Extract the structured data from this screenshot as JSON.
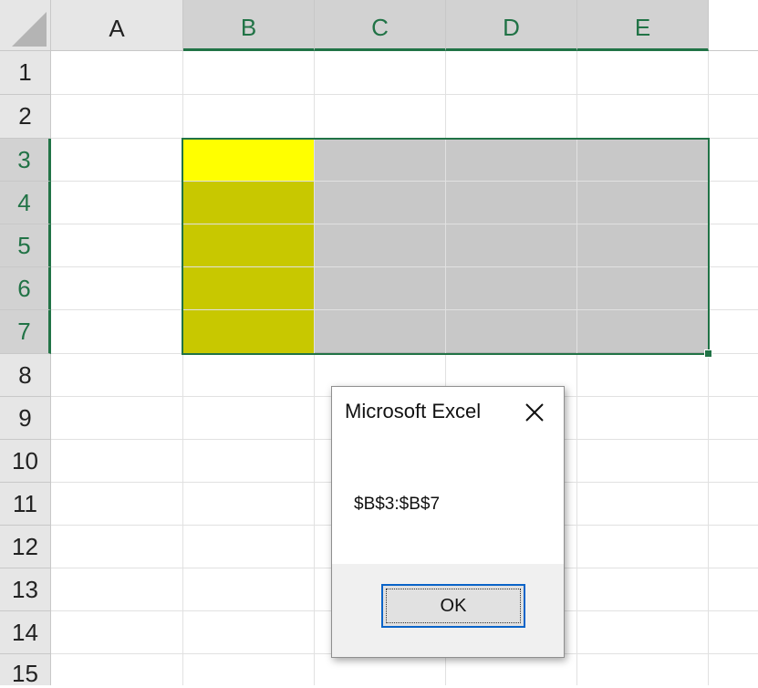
{
  "columns": [
    {
      "label": "A",
      "selected": false
    },
    {
      "label": "B",
      "selected": true
    },
    {
      "label": "C",
      "selected": true
    },
    {
      "label": "D",
      "selected": true
    },
    {
      "label": "E",
      "selected": true
    }
  ],
  "rows": [
    {
      "label": "1",
      "selected": false
    },
    {
      "label": "2",
      "selected": false
    },
    {
      "label": "3",
      "selected": true
    },
    {
      "label": "4",
      "selected": true
    },
    {
      "label": "5",
      "selected": true
    },
    {
      "label": "6",
      "selected": true
    },
    {
      "label": "7",
      "selected": true
    },
    {
      "label": "8",
      "selected": false
    },
    {
      "label": "9",
      "selected": false
    },
    {
      "label": "10",
      "selected": false
    },
    {
      "label": "11",
      "selected": false
    },
    {
      "label": "12",
      "selected": false
    },
    {
      "label": "13",
      "selected": false
    },
    {
      "label": "14",
      "selected": false
    },
    {
      "label": "15",
      "selected": false
    }
  ],
  "colors": {
    "selection_accent": "#217346",
    "active_cell_fill": "#ffff00",
    "highlighted_range_fill": "#c8c800",
    "selected_range_fill": "#c8c8c8",
    "ok_button_focus": "#0a64c8"
  },
  "dialog": {
    "title": "Microsoft Excel",
    "close_icon": "close-icon",
    "message": "$B$3:$B$7",
    "ok_label": "OK"
  }
}
